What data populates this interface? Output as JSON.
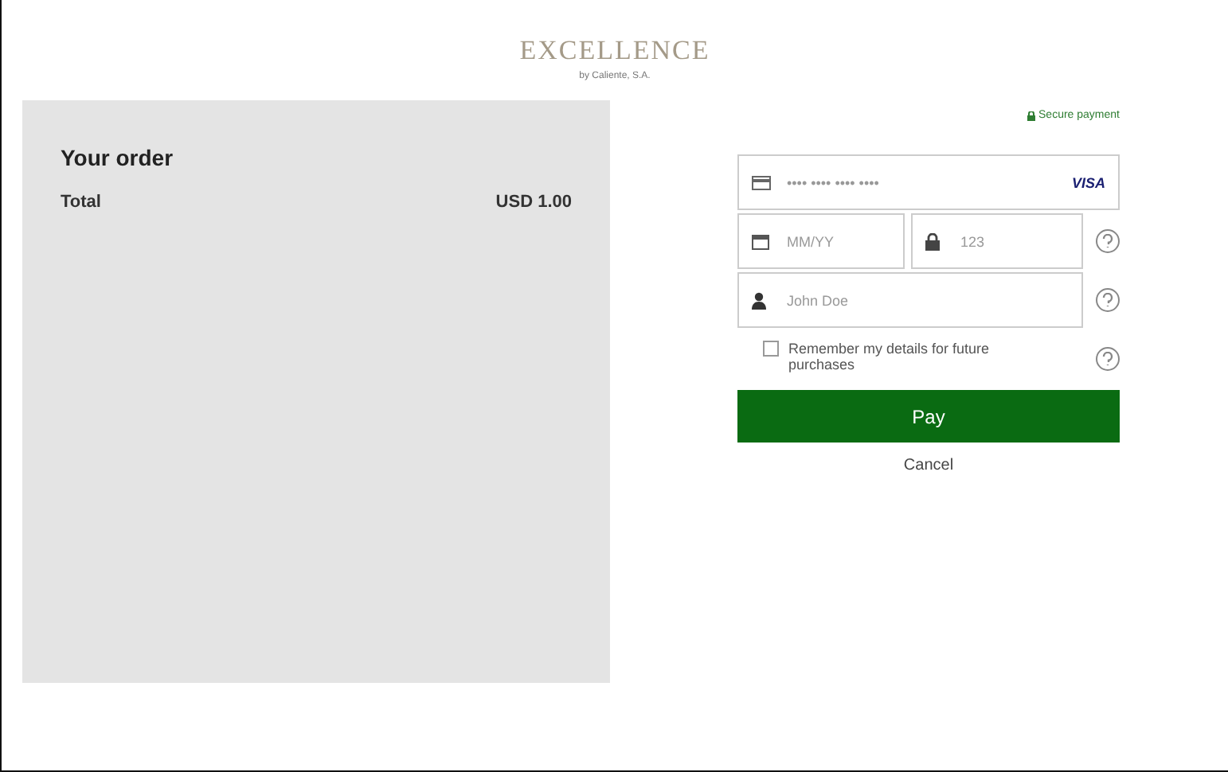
{
  "brand": {
    "name": "EXCELLENCE",
    "tagline": "by Caliente, S.A."
  },
  "order": {
    "title": "Your order",
    "total_label": "Total",
    "total_value": "USD 1.00"
  },
  "payment": {
    "secure_label": "Secure payment",
    "card_placeholder": "•••• •••• •••• ••••",
    "card_brand": "VISA",
    "expiry_placeholder": "MM/YY",
    "cvc_placeholder": "123",
    "name_placeholder": "John Doe",
    "remember": {
      "label": "Remember my details for future purchases",
      "checked": false
    },
    "pay_label": "Pay",
    "cancel_label": "Cancel"
  }
}
